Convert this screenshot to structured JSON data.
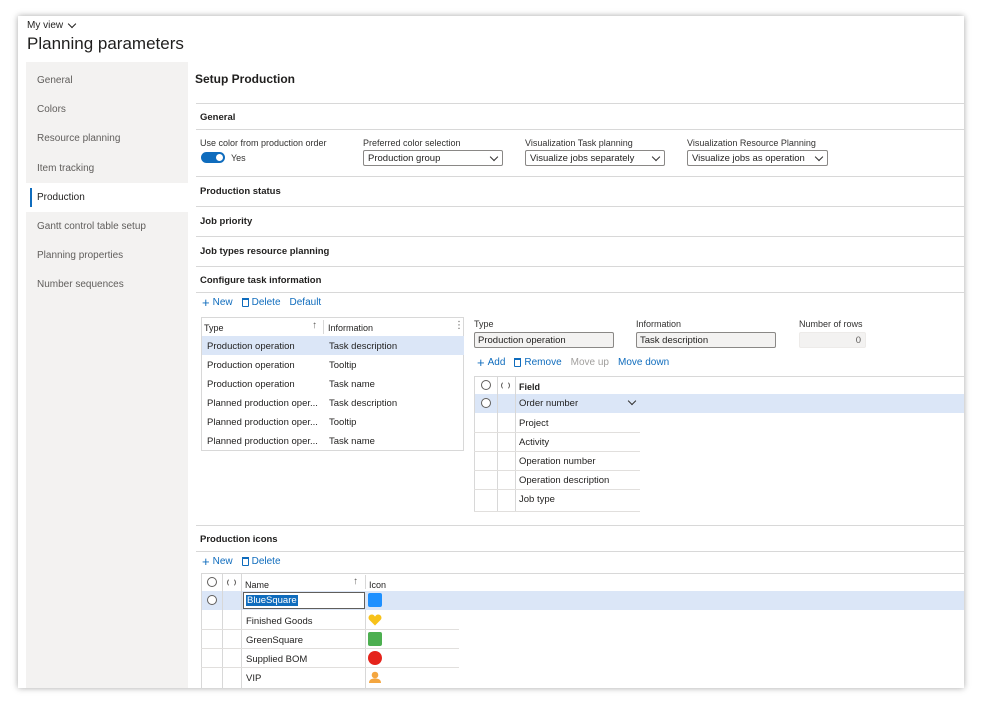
{
  "header": {
    "view_label": "My view",
    "page_title": "Planning parameters"
  },
  "sidebar": {
    "items": [
      {
        "label": "General"
      },
      {
        "label": "Colors"
      },
      {
        "label": "Resource planning"
      },
      {
        "label": "Item tracking"
      },
      {
        "label": "Production"
      },
      {
        "label": "Gantt control table setup"
      },
      {
        "label": "Planning properties"
      },
      {
        "label": "Number sequences"
      }
    ],
    "active": "Production"
  },
  "main": {
    "heading": "Setup Production",
    "general": {
      "title": "General",
      "use_color_label": "Use color from production order",
      "use_color_value": "Yes",
      "preferred_label": "Preferred color selection",
      "preferred_value": "Production group",
      "vis_task_label": "Visualization Task planning",
      "vis_task_value": "Visualize jobs separately",
      "vis_res_label": "Visualization Resource Planning",
      "vis_res_value": "Visualize jobs as operation"
    },
    "sections": {
      "production_status": "Production status",
      "job_priority": "Job priority",
      "job_types": "Job types resource planning",
      "configure": "Configure task information",
      "production_icons": "Production icons"
    },
    "task_toolbar": {
      "new": "New",
      "delete": "Delete",
      "default": "Default"
    },
    "task_grid": {
      "columns": [
        "Type",
        "Information"
      ],
      "rows": [
        {
          "type": "Production operation",
          "info": "Task description"
        },
        {
          "type": "Production operation",
          "info": "Tooltip"
        },
        {
          "type": "Production operation",
          "info": "Task name"
        },
        {
          "type": "Planned production oper...",
          "info": "Task description"
        },
        {
          "type": "Planned production oper...",
          "info": "Tooltip"
        },
        {
          "type": "Planned production oper...",
          "info": "Task name"
        }
      ]
    },
    "detail": {
      "type_label": "Type",
      "type_value": "Production operation",
      "info_label": "Information",
      "info_value": "Task description",
      "rows_label": "Number of rows",
      "rows_value": "0",
      "toolbar": {
        "add": "Add",
        "remove": "Remove",
        "move_up": "Move up",
        "move_down": "Move down"
      },
      "field_header": "Field",
      "fields": [
        "Order number",
        "Project",
        "Activity",
        "Operation number",
        "Operation description",
        "Job type"
      ]
    },
    "icons_toolbar": {
      "new": "New",
      "delete": "Delete"
    },
    "icons_grid": {
      "columns": [
        "Name",
        "Icon"
      ],
      "rows": [
        {
          "name": "BlueSquare",
          "icon": "blue-square-icon",
          "color": "#1e90ff"
        },
        {
          "name": "Finished Goods",
          "icon": "yellow-heart-icon",
          "color": "#f7c21a"
        },
        {
          "name": "GreenSquare",
          "icon": "green-square-icon",
          "color": "#4caf50"
        },
        {
          "name": "Supplied BOM",
          "icon": "red-circle-icon",
          "color": "#e5231b"
        },
        {
          "name": "VIP",
          "icon": "person-icon",
          "color": "#f4a640"
        }
      ]
    }
  },
  "colors": {
    "accent": "#0f6cbd",
    "selected_row": "#dbe6f7",
    "sidebar_bg": "#f3f2f1"
  }
}
